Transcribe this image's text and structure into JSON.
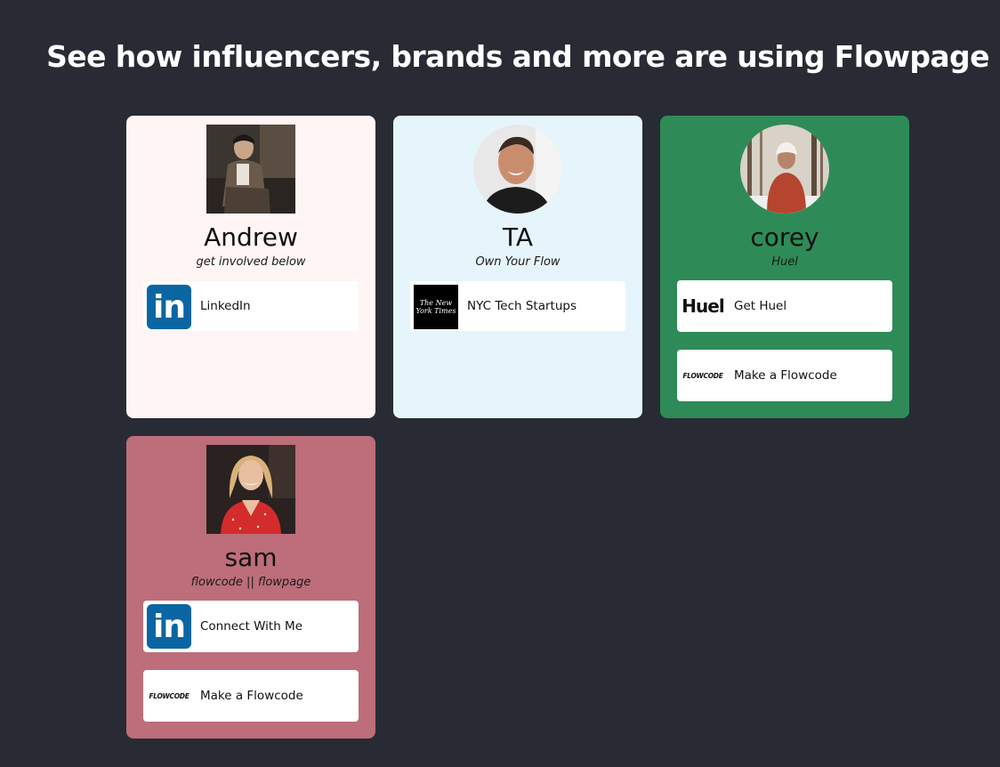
{
  "header": {
    "title": "See how influencers, brands and more are using Flowpage"
  },
  "cards": [
    {
      "name": "Andrew",
      "tagline": "get involved below",
      "background": "#fff5f5",
      "avatar_shape": "square",
      "links": [
        {
          "label": "LinkedIn",
          "icon": "linkedin-icon",
          "logo_text": "in"
        }
      ]
    },
    {
      "name": "TA",
      "tagline": "Own Your Flow",
      "background": "#e6f5fb",
      "avatar_shape": "circle",
      "links": [
        {
          "label": "NYC Tech Startups",
          "icon": "nyt-logo-icon",
          "logo_text": "The New York Times"
        }
      ]
    },
    {
      "name": "corey",
      "tagline": "Huel",
      "background": "#2e8b57",
      "avatar_shape": "circle",
      "links": [
        {
          "label": "Get Huel",
          "icon": "huel-logo-icon",
          "logo_text": "Huel"
        },
        {
          "label": "Make a Flowcode",
          "icon": "flowcode-logo-icon",
          "logo_text": "FLOWCODE"
        }
      ]
    },
    {
      "name": "sam",
      "tagline": "flowcode || flowpage",
      "background": "#bd6e7a",
      "avatar_shape": "square",
      "links": [
        {
          "label": "Connect With Me",
          "icon": "linkedin-icon",
          "logo_text": "in"
        },
        {
          "label": "Make a Flowcode",
          "icon": "flowcode-logo-icon",
          "logo_text": "FLOWCODE"
        }
      ]
    }
  ]
}
